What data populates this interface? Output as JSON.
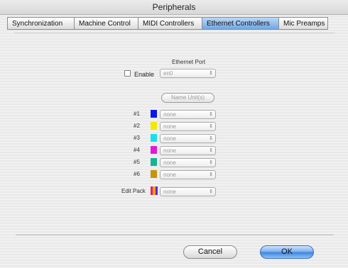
{
  "window": {
    "title": "Peripherals"
  },
  "tabs": [
    {
      "label": "Synchronization"
    },
    {
      "label": "Machine Control"
    },
    {
      "label": "MIDI Controllers"
    },
    {
      "label": "Ethernet Controllers"
    },
    {
      "label": "Mic Preamps"
    }
  ],
  "active_tab": "Ethernet Controllers",
  "ethernet": {
    "port_heading": "Ethernet Port",
    "enable_label": "Enable",
    "enable_checked": false,
    "port_value": "en0",
    "name_units_label": "Name Unit(s)"
  },
  "units": [
    {
      "label": "#1",
      "color": "#0a18e6",
      "value": "none"
    },
    {
      "label": "#2",
      "color": "#f2e800",
      "value": "none"
    },
    {
      "label": "#3",
      "color": "#18e0e8",
      "value": "none"
    },
    {
      "label": "#4",
      "color": "#e419d6",
      "value": "none"
    },
    {
      "label": "#5",
      "color": "#11b694",
      "value": "none"
    },
    {
      "label": "#6",
      "color": "#c8920d",
      "value": "none"
    }
  ],
  "edit_pack": {
    "label": "Edit Pack",
    "colors": [
      "#e41e6a",
      "#f4a000",
      "#5a2bd6"
    ],
    "value": "none"
  },
  "buttons": {
    "cancel": "Cancel",
    "ok": "OK"
  }
}
